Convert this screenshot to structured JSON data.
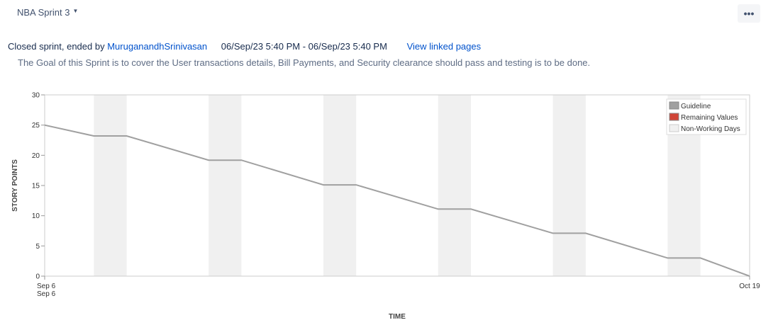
{
  "header": {
    "sprint_name": "NBA Sprint 3",
    "more_label": "•••"
  },
  "meta": {
    "prefix": "Closed sprint, ended by",
    "user": "MuruganandhSrinivasan",
    "dates": "06/Sep/23 5:40 PM - 06/Sep/23 5:40 PM",
    "linked_pages": "View linked pages"
  },
  "goal": "The Goal of this Sprint is to cover the User transactions details, Bill Payments, and Security clearance should pass and testing is to be done.",
  "colors": {
    "guideline": "#a0a0a0",
    "remaining": "#d04437",
    "non_working": "#f0f0f0"
  },
  "chart_data": {
    "type": "line",
    "title": "",
    "xlabel": "TIME",
    "ylabel": "STORY POINTS",
    "ylim": [
      0,
      30
    ],
    "yticks": [
      0,
      5,
      10,
      15,
      20,
      25,
      30
    ],
    "x_start_labels": [
      "Sep 6",
      "Sep 6"
    ],
    "x_end_label": "Oct 19",
    "grid": false,
    "legend_position": "top-right",
    "legend": [
      "Guideline",
      "Remaining Values",
      "Non-Working Days"
    ],
    "non_working_periods": [
      [
        "Sep 9",
        "Sep 11"
      ],
      [
        "Sep 16",
        "Sep 18"
      ],
      [
        "Sep 23",
        "Sep 25"
      ],
      [
        "Sep 30",
        "Oct 2"
      ],
      [
        "Oct 7",
        "Oct 9"
      ],
      [
        "Oct 14",
        "Oct 16"
      ]
    ],
    "series": [
      {
        "name": "Guideline",
        "points": [
          [
            "Sep 6",
            25
          ],
          [
            "Sep 9",
            23.2
          ],
          [
            "Sep 11",
            23.2
          ],
          [
            "Sep 16",
            19.2
          ],
          [
            "Sep 18",
            19.2
          ],
          [
            "Sep 23",
            15.1
          ],
          [
            "Sep 25",
            15.1
          ],
          [
            "Sep 30",
            11.1
          ],
          [
            "Oct 2",
            11.1
          ],
          [
            "Oct 7",
            7.1
          ],
          [
            "Oct 9",
            7.1
          ],
          [
            "Oct 14",
            3
          ],
          [
            "Oct 16",
            3
          ],
          [
            "Oct 19",
            0
          ]
        ]
      }
    ]
  }
}
